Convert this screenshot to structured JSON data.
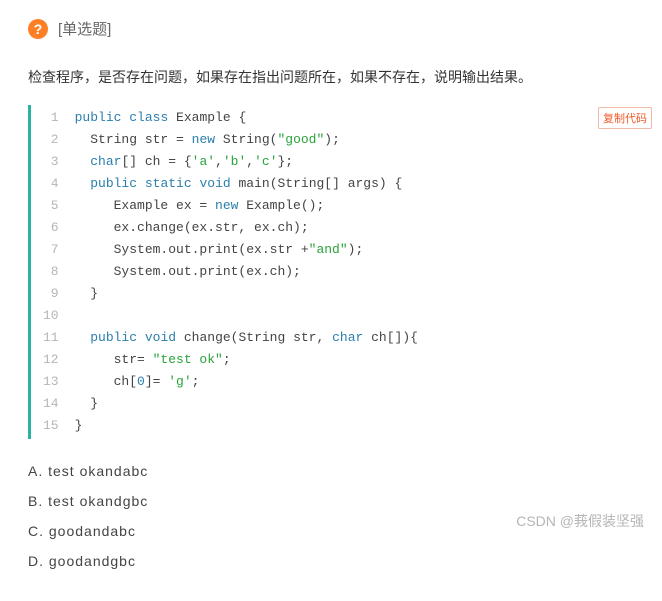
{
  "header": {
    "icon_glyph": "?",
    "type_label": "[单选题]"
  },
  "prompt": "检查程序，是否存在问题，如果存在指出问题所在，如果不存在，说明输出结果。",
  "code_lines": [
    {
      "n": 1,
      "html": "<span class='kw'>public</span> <span class='kw'>class</span> Example {"
    },
    {
      "n": 2,
      "html": "  String str = <span class='kw'>new</span> String(<span class='str'>\"good\"</span>);"
    },
    {
      "n": 3,
      "html": "  <span class='kw'>char</span>[] ch = {<span class='str'>'a'</span>,<span class='str'>'b'</span>,<span class='str'>'c'</span>};"
    },
    {
      "n": 4,
      "html": "  <span class='kw'>public</span> <span class='kw'>static</span> <span class='kw'>void</span> main(String[] args) {"
    },
    {
      "n": 5,
      "html": "     Example ex = <span class='kw'>new</span> Example();"
    },
    {
      "n": 6,
      "html": "     ex.change(ex.str, ex.ch);"
    },
    {
      "n": 7,
      "html": "     System.out.print(ex.str +<span class='str'>\"and\"</span>);"
    },
    {
      "n": 8,
      "html": "     System.out.print(ex.ch);"
    },
    {
      "n": 9,
      "html": "  }"
    },
    {
      "n": 10,
      "html": ""
    },
    {
      "n": 11,
      "html": "  <span class='kw'>public</span> <span class='kw'>void</span> change(String str, <span class='kw'>char</span> ch[]){"
    },
    {
      "n": 12,
      "html": "     str= <span class='str'>\"test ok\"</span>;"
    },
    {
      "n": 13,
      "html": "     ch[<span class='kw'>0</span>]= <span class='str'>'g'</span>;"
    },
    {
      "n": 14,
      "html": "  }"
    },
    {
      "n": 15,
      "html": "}"
    }
  ],
  "copy_label": "复制代码",
  "options": [
    {
      "letter": "A",
      "text": "test okandabc"
    },
    {
      "letter": "B",
      "text": "test okandgbc"
    },
    {
      "letter": "C",
      "text": "goodandabc"
    },
    {
      "letter": "D",
      "text": "goodandgbc"
    }
  ],
  "watermark": "CSDN @莪假装坚强"
}
